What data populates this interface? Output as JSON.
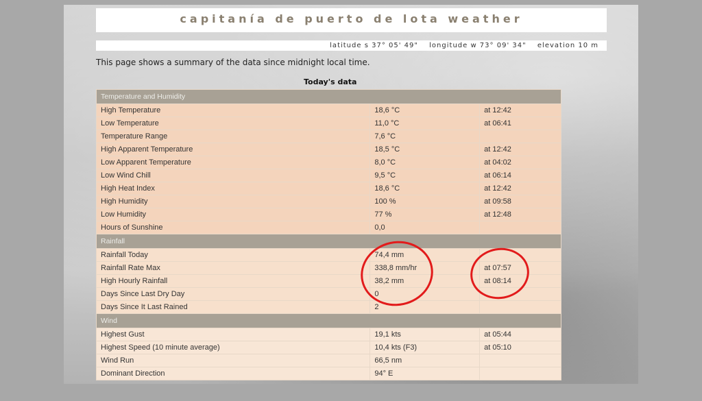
{
  "header": {
    "title": "capitanía de puerto de lota weather",
    "latitude": "latitude s 37° 05' 49\"",
    "longitude": "longitude w 73° 09' 34\"",
    "elevation": "elevation 10 m"
  },
  "intro": "This page shows a summary of the data since midnight local time.",
  "today_heading": "Today's data",
  "sections": {
    "temp": {
      "title": "Temperature and Humidity",
      "rows": [
        {
          "label": "High Temperature",
          "value": "18,6 °C",
          "time": "at 12:42"
        },
        {
          "label": "Low Temperature",
          "value": "11,0 °C",
          "time": "at 06:41"
        },
        {
          "label": "Temperature Range",
          "value": "7,6 °C",
          "time": ""
        },
        {
          "label": "High Apparent Temperature",
          "value": "18,5 °C",
          "time": "at 12:42"
        },
        {
          "label": "Low Apparent Temperature",
          "value": "8,0 °C",
          "time": "at 04:02"
        },
        {
          "label": "Low Wind Chill",
          "value": "9,5 °C",
          "time": "at 06:14"
        },
        {
          "label": "High Heat Index",
          "value": "18,6 °C",
          "time": "at 12:42"
        },
        {
          "label": "High Humidity",
          "value": "100 %",
          "time": "at 09:58"
        },
        {
          "label": "Low Humidity",
          "value": "77 %",
          "time": "at 12:48"
        },
        {
          "label": "Hours of Sunshine",
          "value": "0,0",
          "time": ""
        }
      ]
    },
    "rain": {
      "title": "Rainfall",
      "rows": [
        {
          "label": "Rainfall Today",
          "value": "74,4 mm",
          "time": ""
        },
        {
          "label": "Rainfall Rate Max",
          "value": "338,8 mm/hr",
          "time": "at 07:57"
        },
        {
          "label": "High Hourly Rainfall",
          "value": "38,2 mm",
          "time": "at 08:14"
        },
        {
          "label": "Days Since Last Dry Day",
          "value": "0",
          "time": ""
        },
        {
          "label": "Days Since It Last Rained",
          "value": "2",
          "time": ""
        }
      ]
    },
    "wind": {
      "title": "Wind",
      "rows": [
        {
          "label": "Highest Gust",
          "value": "19,1 kts",
          "time": "at 05:44"
        },
        {
          "label": "Highest Speed (10 minute average)",
          "value": "10,4 kts (F3)",
          "time": "at 05:10"
        },
        {
          "label": "Wind Run",
          "value": "66,5 nm",
          "time": ""
        },
        {
          "label": "Dominant Direction",
          "value": "94° E",
          "time": ""
        }
      ]
    }
  },
  "colors": {
    "section_header": "#a8a195",
    "temp_row": "#f4d4bc",
    "annotation": "#e21b1b"
  }
}
